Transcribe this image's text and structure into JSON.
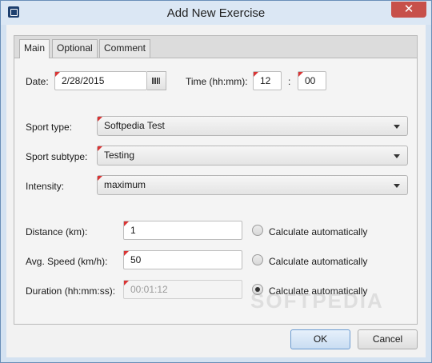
{
  "window": {
    "title": "Add New Exercise",
    "close_glyph": "✕"
  },
  "tabs": [
    {
      "label": "Main",
      "active": true
    },
    {
      "label": "Optional",
      "active": false
    },
    {
      "label": "Comment",
      "active": false
    }
  ],
  "main": {
    "date_label": "Date:",
    "date_value": "2/28/2015",
    "time_label": "Time (hh:mm):",
    "time_hour": "12",
    "time_sep": ":",
    "time_minute": "00",
    "sport_type_label": "Sport type:",
    "sport_type_value": "Softpedia Test",
    "sport_subtype_label": "Sport subtype:",
    "sport_subtype_value": "Testing",
    "intensity_label": "Intensity:",
    "intensity_value": "maximum",
    "distance_label": "Distance (km):",
    "distance_value": "1",
    "avg_speed_label": "Avg. Speed (km/h):",
    "avg_speed_value": "50",
    "duration_label": "Duration (hh:mm:ss):",
    "duration_value": "00:01:12",
    "calc_auto_label": "Calculate automatically",
    "calc_selected": "duration"
  },
  "buttons": {
    "ok": "OK",
    "cancel": "Cancel"
  },
  "watermark": "SOFTPEDIA",
  "colors": {
    "required_marker": "#d93535",
    "default_button": "#c9ddf2",
    "title_bar": "#dbe7f4"
  },
  "icons": {
    "calendar": "calendar-icon",
    "dropdown": "chevron-down-icon",
    "app": "app-icon",
    "close": "close-icon"
  }
}
